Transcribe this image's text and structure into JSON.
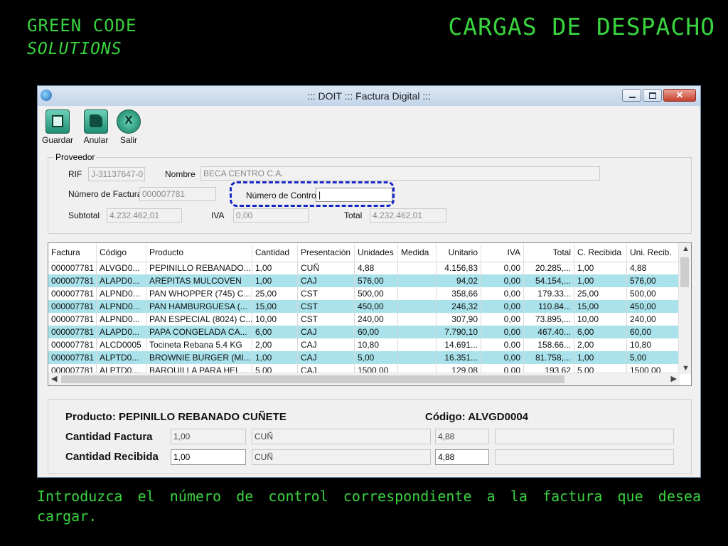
{
  "slide": {
    "brand_line1": "GREEN CODE",
    "brand_line2": "SOLUTIONS",
    "title": "CARGAS DE DESPACHO",
    "caption": "Introduzca el número de control correspondiente a la factura que desea cargar.",
    "accent_color": "#39d33f"
  },
  "window": {
    "title": "::: DOIT ::: Factura Digital :::",
    "close_label": "✕"
  },
  "toolbar": {
    "guardar": "Guardar",
    "anular": "Anular",
    "salir": "Salir",
    "salir_glyph": "X"
  },
  "proveedor": {
    "legend": "Proveedor",
    "rif_label": "RIF",
    "rif_value": "J-31137647-0",
    "nombre_label": "Nombre",
    "nombre_value": "BECA CENTRO C.A.",
    "num_factura_label": "Número de Factura",
    "num_factura_value": "000007781",
    "num_control_label": "Número de Control",
    "num_control_value": "|",
    "subtotal_label": "Subtotal",
    "subtotal_value": "4.232.462,01",
    "iva_label": "IVA",
    "iva_value": "0,00",
    "total_label": "Total",
    "total_value": "4.232.462,01"
  },
  "grid": {
    "columns": [
      "Factura",
      "Código",
      "Producto",
      "Cantidad",
      "Presentación",
      "Unidades",
      "Medida",
      "Unitario",
      "IVA",
      "Total",
      "C. Recibida",
      "Uni. Recib."
    ],
    "rows": [
      [
        "000007781",
        "ALVGD0...",
        "PEPINILLO REBANADO...",
        "1,00",
        "CUÑ",
        "4,88",
        "",
        "4.156,83",
        "0,00",
        "20.285,...",
        "1,00",
        "4,88"
      ],
      [
        "000007781",
        "ALAPD0...",
        "AREPITAS MULCOVEN",
        "1,00",
        "CAJ",
        "576,00",
        "",
        "94,02",
        "0,00",
        "54.154,...",
        "1,00",
        "576,00"
      ],
      [
        "000007781",
        "ALPND0...",
        "PAN WHOPPER (745) C...",
        "25,00",
        "CST",
        "500,00",
        "",
        "358,66",
        "0,00",
        "179.33...",
        "25,00",
        "500,00"
      ],
      [
        "000007781",
        "ALPND0...",
        "PAN HAMBURGUESA (...",
        "15,00",
        "CST",
        "450,00",
        "",
        "246,32",
        "0,00",
        "110.84...",
        "15,00",
        "450,00"
      ],
      [
        "000007781",
        "ALPND0...",
        "PAN ESPECIAL (8024) C...",
        "10,00",
        "CST",
        "240,00",
        "",
        "307,90",
        "0,00",
        "73.895,...",
        "10,00",
        "240,00"
      ],
      [
        "000007781",
        "ALAPD0...",
        "PAPA CONGELADA CA...",
        "6,00",
        "CAJ",
        "60,00",
        "",
        "7.790,10",
        "0,00",
        "467.40...",
        "6,00",
        "60,00"
      ],
      [
        "000007781",
        "ALCD0005",
        "Tocineta Rebana 5.4 KG",
        "2,00",
        "CAJ",
        "10,80",
        "",
        "14.691...",
        "0,00",
        "158.66...",
        "2,00",
        "10,80"
      ],
      [
        "000007781",
        "ALPTD0...",
        "BROWNIE BURGER (MI...",
        "1,00",
        "CAJ",
        "5,00",
        "",
        "16.351...",
        "0,00",
        "81.758,...",
        "1,00",
        "5,00"
      ],
      [
        "000007781",
        "ALPTD0...",
        "BARQUILLA PARA HEL...",
        "5,00",
        "CAJ",
        "1500,00",
        "",
        "129,08",
        "0,00",
        "193,62",
        "5,00",
        "1500,00"
      ]
    ]
  },
  "detail": {
    "producto_label": "Producto: PEPINILLO REBANADO CUÑETE",
    "codigo_label": "Código: ALVGD0004",
    "cant_factura_label": "Cantidad Factura",
    "cant_factura_value": "1,00",
    "cant_factura_pres": "CUÑ",
    "cant_factura_unid": "4,88",
    "cant_recibida_label": "Cantidad Recibida",
    "cant_recibida_value": "1,00",
    "cant_recibida_pres": "CUÑ",
    "cant_recibida_unid": "4,88"
  }
}
